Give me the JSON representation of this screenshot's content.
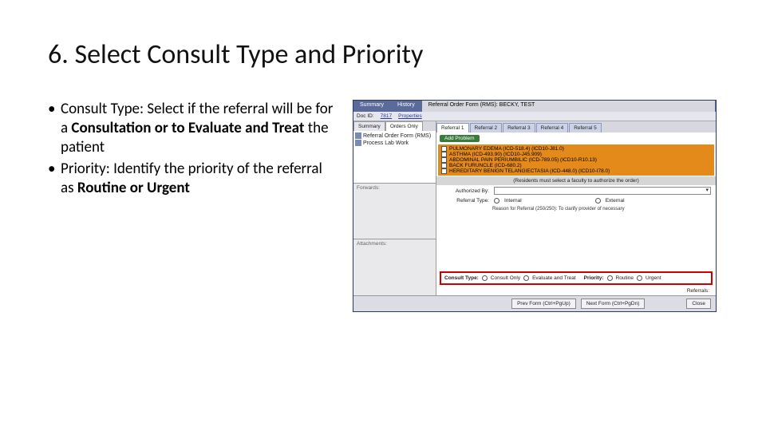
{
  "title": "6. Select Consult Type and Priority",
  "bullets": {
    "b1_pre": "Consult Type: Select if the referral will be for a ",
    "b1_bold": "Consultation or to Evaluate and Treat ",
    "b1_post": "the patient",
    "b2_pre": "Priority: Identify the priority of the referral as ",
    "b2_bold": "Routine or Urgent"
  },
  "shot": {
    "toptabs": [
      "Summary",
      "History"
    ],
    "form_title": "Referral Order Form (RMS): BECKY, TEST",
    "toolbar": {
      "docid": "Doc ID:",
      "docid_val": "7817",
      "prop": "Properties"
    },
    "left": {
      "subtabs": [
        "Summary",
        "Orders Only"
      ],
      "items": [
        "Referral Order Form (RMS)",
        "Process Lab Work"
      ],
      "forwards": "Forwards:",
      "attachments": "Attachments:"
    },
    "right": {
      "tabs": [
        "Referral 1",
        "Referral 2",
        "Referral 3",
        "Referral 4",
        "Referral 5"
      ],
      "add_problem": "Add Problem",
      "problems": [
        "PULMONARY EDEMA (ICD-518.4) (ICD10-J81.0)",
        "ASTHMA (ICD-493.90) (ICD10-J45.909)",
        "ABDOMINAL PAIN PERIUMBILIC (ICD-789.05) (ICD10-R10.13)",
        "BACK FURUNCLE (ICD-680.2)",
        "HEREDITARY BENIGN TELANGIECTASIA (ICD-448.0) (ICD10-I78.0)"
      ],
      "residents_note": "(Residents must select a faculty to authorize the order)",
      "authorized_by": "Authorized By:",
      "referral_type": "Referral Type:",
      "rt_internal": "Internal",
      "rt_external": "External",
      "reason_text": "Reason for Referral (250/250): To clarify provider of necessary",
      "consult_type_lbl": "Consult Type:",
      "ct_consult": "Consult Only",
      "ct_eval": "Evaluate and Treat",
      "priority_lbl": "Priority:",
      "pr_routine": "Routine",
      "pr_urgent": "Urgent",
      "referrals": "Referrals:"
    },
    "footer": {
      "prev": "Prev Form (Ctrl+PgUp)",
      "next": "Next Form (Ctrl+PgDn)",
      "close": "Close"
    }
  }
}
